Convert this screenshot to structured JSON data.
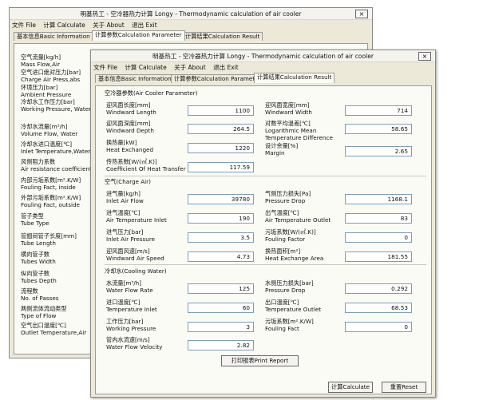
{
  "window1": {
    "title": "明基热工 - 空冷器热力计算 Longy - Thermodynamic calculation of air cooler",
    "close_label": "×",
    "menu": [
      "文件 File",
      "计算 Calculate",
      "关于 About",
      "退出 Exit"
    ],
    "tabs": [
      "基本信息Basic Information",
      "计算参数Calculation Parameter",
      "计算结果Calculation Result"
    ],
    "params": [
      {
        "cn": "空气流量[kg/h]",
        "en": "Mass Flow,Air"
      },
      {
        "cn": "空气进口绝对压力[bar]",
        "en": "Charge Air Press,abs"
      },
      {
        "cn": "环境压力[bar]",
        "en": "Ambient Pressure"
      },
      {
        "cn": "冷却水工作压力[bar]",
        "en": "Working Pressure, Water"
      },
      {
        "cn": "冷却水流量[m³/h]",
        "en": "Volume Flow, Water"
      },
      {
        "cn": "冷却水进口温度[℃]",
        "en": "Inlet Temperature,Water"
      },
      {
        "cn": "风侧阻力系数",
        "en": "Air resistance coefficient"
      },
      {
        "cn": "内部污垢系数[m².K/W]",
        "en": "Fouling Fact, inside"
      },
      {
        "cn": "外部污垢系数[m².K/W]",
        "en": "Fouling Fact, outside"
      },
      {
        "cn": "管子类型",
        "en": "Tube Type"
      },
      {
        "cn": "管翅间管子长度[mm]",
        "en": "Tube Length"
      },
      {
        "cn": "横向管子数",
        "en": "Tubes Width"
      },
      {
        "cn": "纵向管子数",
        "en": "Tubes Depth"
      },
      {
        "cn": "流程数",
        "en": "No. of Passes"
      },
      {
        "cn": "两侧流体流动类型",
        "en": "Type of Flow"
      },
      {
        "cn": "空气出口温度[℃]",
        "en": "Outlet Temperature,Air"
      }
    ]
  },
  "window2": {
    "title": "明基热工 - 空冷器热力计算 Longy - Thermodynamic calculation of air cooler",
    "close_label": "×",
    "menu": [
      "文件 File",
      "计算 Calculate",
      "关于 About",
      "退出 Exit"
    ],
    "tabs": [
      "基本信息Basic Information",
      "计算参数Calculation Parameter",
      "计算结果Calculation Result"
    ],
    "section_cooler": "空冷器参数(Air Cooler Parameter)",
    "section_air": "空气(Charge Air)",
    "section_water": "冷却水(Cooling Water)",
    "cooler": [
      {
        "cn": "迎风面长度[mm]",
        "en": "Windward Length",
        "value": "1100"
      },
      {
        "cn": "迎风面宽度[mm]",
        "en": "Windward Width",
        "value": "714"
      },
      {
        "cn": "迎风面深度[mm]",
        "en": "Windward Depth",
        "value": "264.5"
      },
      {
        "cn": "对数平均温差[℃]",
        "en": "Logarithmic Mean",
        "en2": "Temperature Difference",
        "value": "58.65"
      },
      {
        "cn": "换热量[kW]",
        "en": "Heat Exchanged",
        "value": "1220"
      },
      {
        "cn": "设计余量[%]",
        "en": "Margin",
        "value": "2.65"
      },
      {
        "cn": "传热系数[W/(㎡.K)]",
        "en": "Coefficient Of Heat Transfer",
        "value": "117.59"
      }
    ],
    "air": [
      {
        "cn": "进气量[kg/h]",
        "en": "Inlet Air Flow",
        "value": "39780"
      },
      {
        "cn": "气侧压力损失[Pa]",
        "en": "Pressure Drop",
        "value": "1168.1"
      },
      {
        "cn": "进气温度[℃]",
        "en": "Air Temperature Inlet",
        "value": "190"
      },
      {
        "cn": "出气温度[℃]",
        "en": "Air Temperature Outlet",
        "value": "83"
      },
      {
        "cn": "进气压力[bar]",
        "en": "Inlet Air Pressure",
        "value": "3.5"
      },
      {
        "cn": "污垢系数[W/(㎡.K)]",
        "en": "Fouling Factor",
        "value": "0"
      },
      {
        "cn": "迎风面风速[m/s]",
        "en": "Windward Air Speed",
        "value": "4.73"
      },
      {
        "cn": "换热面积[m²]",
        "en": "Heat Exchange Area",
        "value": "181.55"
      }
    ],
    "water": [
      {
        "cn": "水流量[m³/h]",
        "en": "Water Flow Rate",
        "value": "125"
      },
      {
        "cn": "水侧压力损失[bar]",
        "en": "Pressure Drop",
        "value": "0.292"
      },
      {
        "cn": "进口温度[℃]",
        "en": "Temperature Inlet",
        "value": "60"
      },
      {
        "cn": "出口温度[℃]",
        "en": "Temperature Outlet",
        "value": "68.53"
      },
      {
        "cn": "工作压力[bar]",
        "en": "Working Pressure",
        "value": "3"
      },
      {
        "cn": "污垢系数[m².K/W]",
        "en": "Fouling Fact",
        "value": "0"
      },
      {
        "cn": "管内水流速[m/s]",
        "en": "Water Flow Velocity",
        "value": "2.82"
      }
    ],
    "print_label": "打印报表Print Report",
    "calc_label": "计算Calculate",
    "reset_label": "重置Reset"
  }
}
